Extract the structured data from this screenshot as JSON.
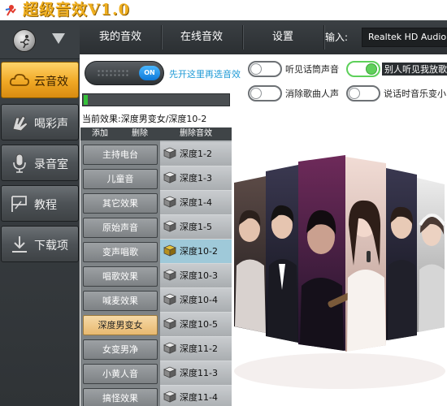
{
  "app": {
    "title": "超级音效V1.0"
  },
  "sidebar": {
    "items": [
      {
        "label": "云音效",
        "icon": "cloud-icon",
        "active": true
      },
      {
        "label": "喝彩声",
        "icon": "applause-icon",
        "active": false
      },
      {
        "label": "录音室",
        "icon": "microphone-icon",
        "active": false
      },
      {
        "label": "教程",
        "icon": "tutorial-icon",
        "active": false
      },
      {
        "label": "下载项",
        "icon": "download-icon",
        "active": false
      }
    ]
  },
  "nav": {
    "tabs": [
      "我的音效",
      "在线音效",
      "设置"
    ],
    "input_label": "输入:",
    "input_value": "Realtek HD Audio Mi"
  },
  "controls": {
    "master_on_label": "ON",
    "master_hint": "先开这里再选音效",
    "switches": [
      {
        "label": "听见话筒声音",
        "on": false
      },
      {
        "label": "别人听见我放歌",
        "on": true
      },
      {
        "label": "消除歌曲人声",
        "on": false
      },
      {
        "label": "说话时音乐变小",
        "on": false
      }
    ]
  },
  "effects": {
    "current": "当前效果:深度男变女/深度10-2",
    "headers": {
      "add": "添加",
      "delete": "删除",
      "delete_effect": "删除音效"
    },
    "categories": [
      "主持电台",
      "儿童音",
      "其它效果",
      "原始声音",
      "变声唱歌",
      "唱歌效果",
      "喊麦效果",
      "深度男变女",
      "女变男净",
      "小黄人音",
      "搞怪效果"
    ],
    "selected_category": "深度男变女",
    "presets": [
      "深度1-2",
      "深度1-3",
      "深度1-4",
      "深度1-5",
      "深度10-2",
      "深度10-3",
      "深度10-4",
      "深度10-5",
      "深度11-2",
      "深度11-3",
      "深度11-4"
    ],
    "selected_preset": "深度10-2",
    "progress_fraction": 0.03
  },
  "colors": {
    "accent_orange": "#f0a825",
    "toggle_blue": "#0d78d8",
    "switch_green": "#5fd05b",
    "hint_blue": "#1e9ad6"
  }
}
